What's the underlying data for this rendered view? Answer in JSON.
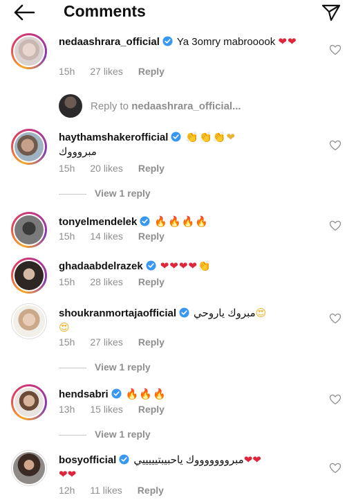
{
  "header": {
    "title": "Comments"
  },
  "reply_to": {
    "prefix": "Reply to ",
    "username": "nedaashrara_official..."
  },
  "comments": [
    {
      "username": "nedaashrara_official",
      "text": "Ya 3omry mabrooook",
      "emoji": "❤❤",
      "time": "15h",
      "likes": "27 likes",
      "reply": "Reply"
    },
    {
      "username": "haythamshakerofficial",
      "emoji": "👏👏👏❤",
      "text": "مبروووك",
      "time": "15h",
      "likes": "20 likes",
      "reply": "Reply",
      "view_replies": "View 1 reply"
    },
    {
      "username": "tonyelmendelek",
      "emoji": "🔥🔥🔥🔥",
      "time": "15h",
      "likes": "14 likes",
      "reply": "Reply"
    },
    {
      "username": "ghadaabdelrazek",
      "emoji_hearts": "❤❤❤❤",
      "emoji_tail": "👏",
      "time": "15h",
      "likes": "28 likes",
      "reply": "Reply"
    },
    {
      "username": "shoukranmortajaofficial",
      "text": "مبروك ياروحي",
      "emoji": "😍",
      "emoji2": "😍",
      "time": "15h",
      "likes": "27 likes",
      "reply": "Reply",
      "view_replies": "View 1 reply"
    },
    {
      "username": "hendsabri",
      "emoji": "🔥🔥🔥",
      "time": "13h",
      "likes": "15 likes",
      "reply": "Reply",
      "view_replies": "View 1 reply"
    },
    {
      "username": "bosyofficial",
      "text": "مبروووووووك ياحبيبتيييييي",
      "emoji": "❤❤",
      "emoji2": "❤❤",
      "time": "12h",
      "likes": "11 likes",
      "reply": "Reply"
    }
  ]
}
